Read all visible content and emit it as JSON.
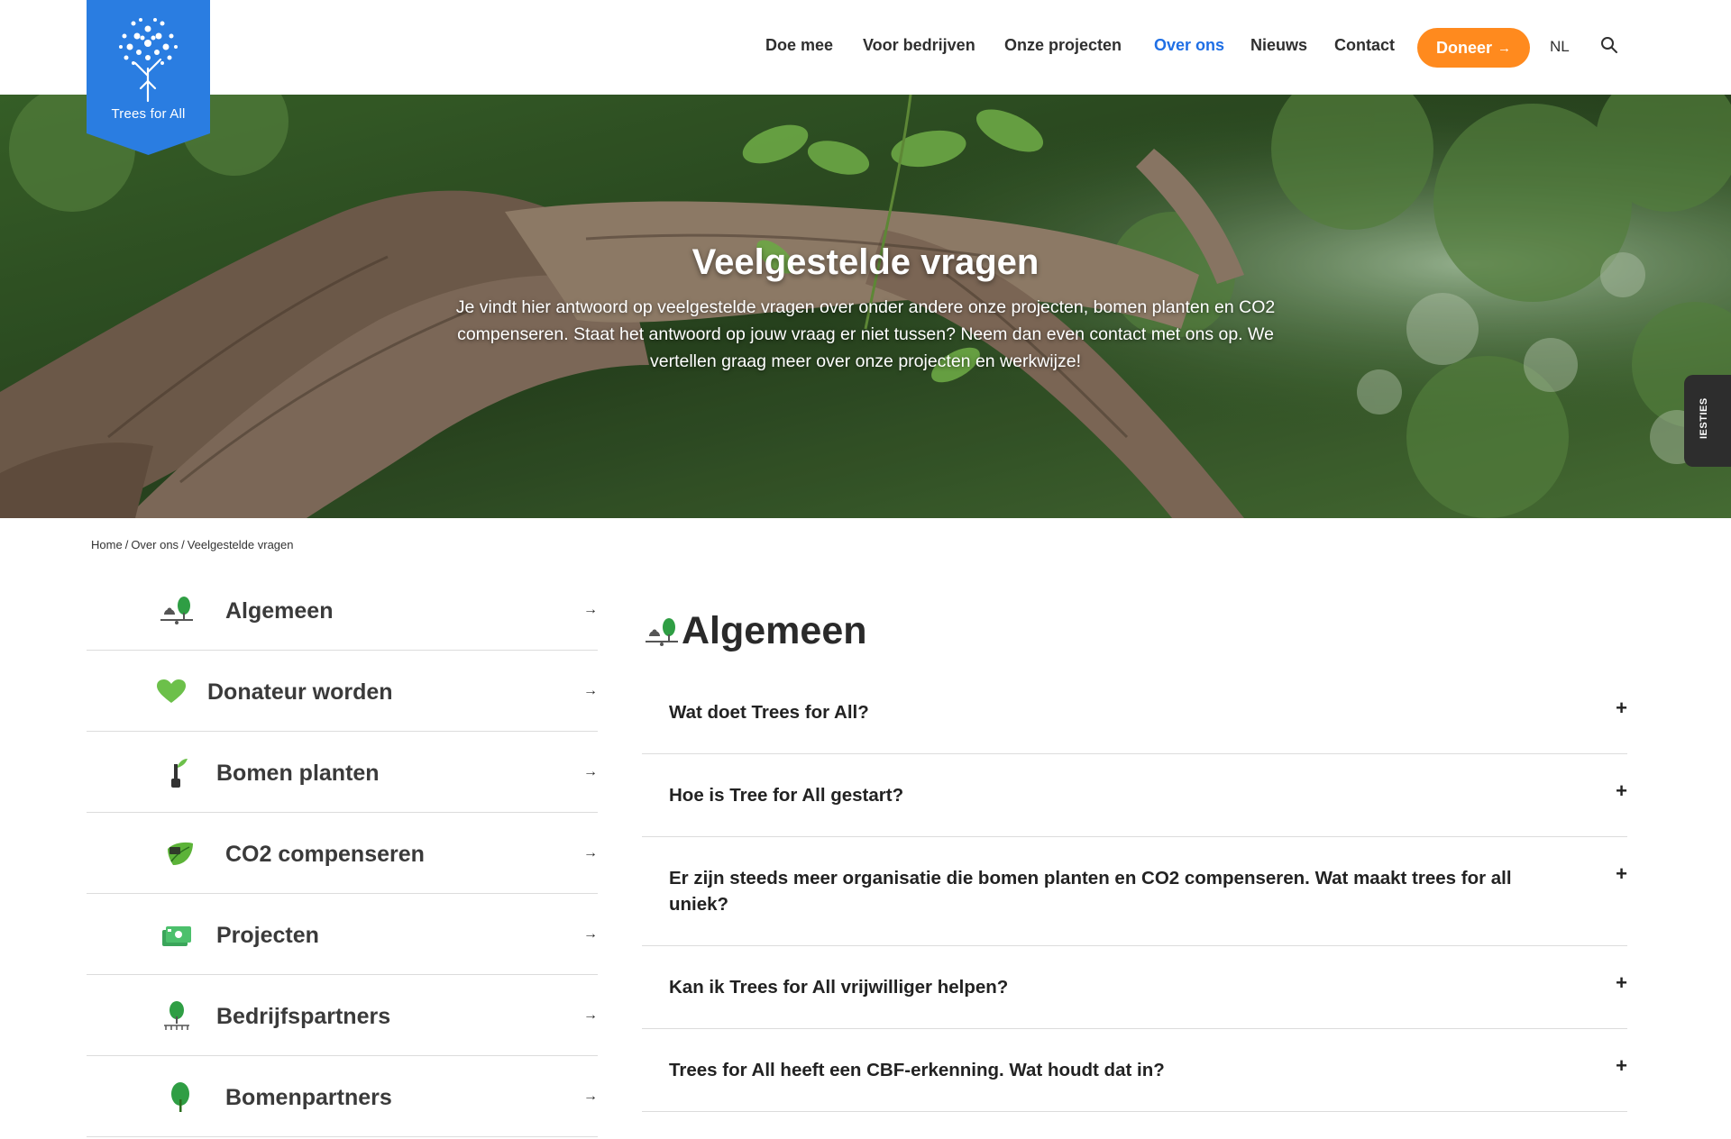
{
  "brand": {
    "name": "Trees for All",
    "logo_color": "#2a7de1"
  },
  "nav": {
    "items": [
      {
        "label": "Doe mee",
        "active": false
      },
      {
        "label": "Voor bedrijven",
        "active": false
      },
      {
        "label": "Onze projecten",
        "active": false
      },
      {
        "label": "Over ons",
        "active": true
      },
      {
        "label": "Nieuws",
        "active": false
      },
      {
        "label": "Contact",
        "active": false
      }
    ],
    "donate_label": "Doneer",
    "donate_icon": "arrow-right-icon",
    "donate_color": "#ff8a1e",
    "language": "NL",
    "search_icon": "search-icon"
  },
  "hero": {
    "title": "Veelgestelde vragen",
    "text": "Je vindt hier antwoord op veelgestelde vragen over onder andere onze projecten, bomen planten en CO2 compenseren. Staat het antwoord op jouw vraag er niet tussen? Neem dan even contact met ons op. We vertellen graag meer over onze projecten en werkwijze!",
    "side_tab_label": "IESTIES"
  },
  "breadcrumb": {
    "items": [
      "Home",
      "Over ons",
      "Veelgestelde vragen"
    ],
    "separator": "/"
  },
  "categories": [
    {
      "label": "Algemeen",
      "icon": "tree-scale-icon"
    },
    {
      "label": "Donateur worden",
      "icon": "heart-icon"
    },
    {
      "label": "Bomen planten",
      "icon": "sapling-icon"
    },
    {
      "label": "CO2 compenseren",
      "icon": "leaf-icon"
    },
    {
      "label": "Projecten",
      "icon": "money-icon"
    },
    {
      "label": "Bedrijfspartners",
      "icon": "tree-roots-icon"
    },
    {
      "label": "Bomenpartners",
      "icon": "tree-icon"
    }
  ],
  "main": {
    "title": "Algemeen",
    "title_icon": "tree-scale-icon",
    "faq": [
      "Wat doet Trees for All?",
      "Hoe is Tree for All gestart?",
      "Er zijn steeds meer organisatie die bomen planten en CO2 compenseren. Wat maakt trees for all uniek?",
      "Kan ik Trees for All vrijwilliger helpen?",
      "Trees for All heeft een CBF-erkenning. Wat houdt dat in?"
    ]
  }
}
